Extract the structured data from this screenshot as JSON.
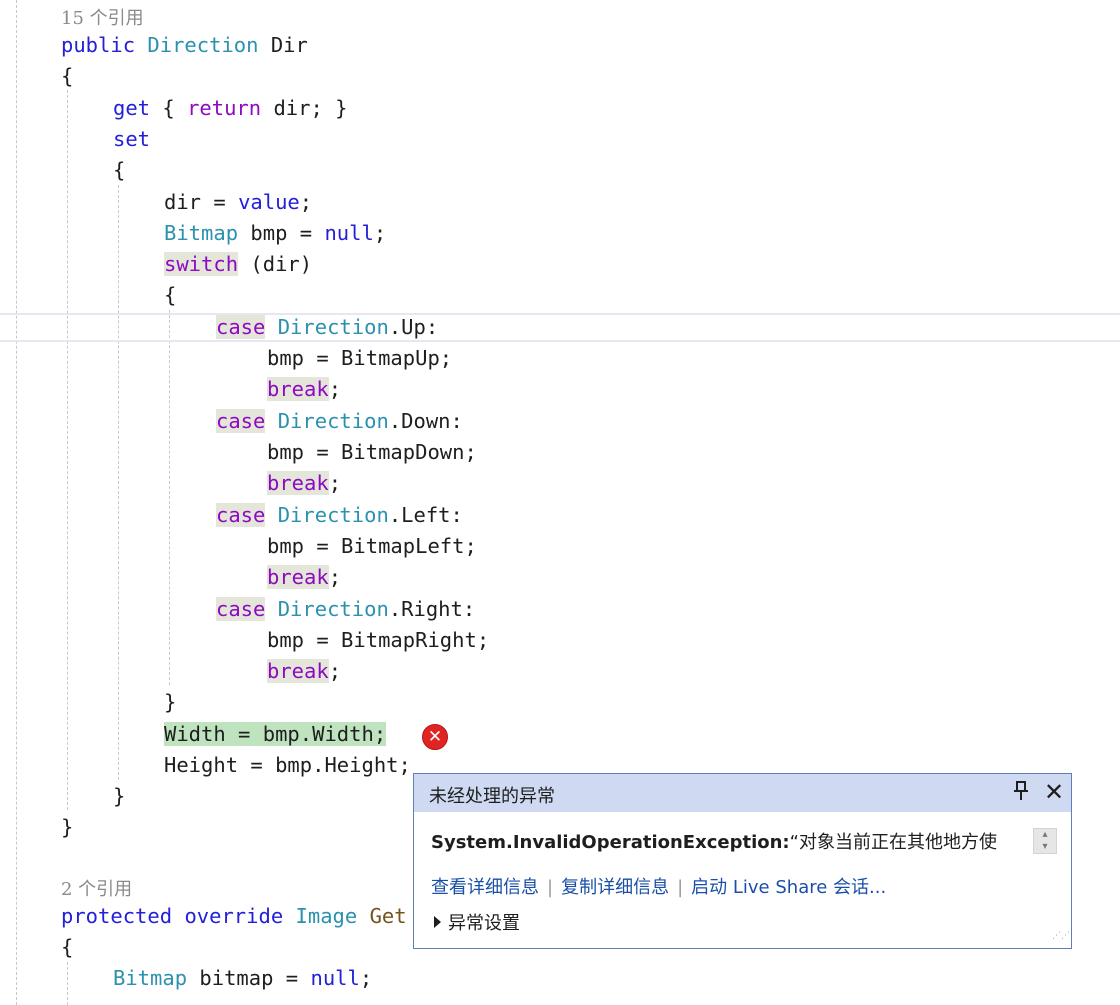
{
  "codelens": {
    "refs_1": "15 个引用",
    "refs_2": "2 个引用"
  },
  "code": {
    "l1_kw": "public",
    "l1_type": "Direction",
    "l1_name": " Dir",
    "l2": "{",
    "l3_get": "get",
    "l3_a": " { ",
    "l3_return": "return",
    "l3_b": " dir; }",
    "l4_set": "set",
    "l5": "{",
    "l6_a": "dir = ",
    "l6_value": "value",
    "l6_b": ";",
    "l7_type": "Bitmap",
    "l7_a": " bmp = ",
    "l7_null": "null",
    "l7_b": ";",
    "l8_switch": "switch",
    "l8_a": " (dir)",
    "l9": "{",
    "case": "case",
    "break": "break",
    "direction": "Direction",
    "up": ".Up:",
    "down": ".Down:",
    "left": ".Left:",
    "right": ".Right:",
    "bmp_up": "bmp = BitmapUp;",
    "bmp_down": "bmp = BitmapDown;",
    "bmp_left": "bmp = BitmapLeft;",
    "bmp_right": "bmp = BitmapRight;",
    "semi": ";",
    "close_switch": "}",
    "width_line": "Width = bmp.Width;",
    "height_line": "Height = bmp.Height;",
    "close_set": "}",
    "close_prop": "}",
    "p_protected": "protected",
    "p_override": "override",
    "p_type": "Image",
    "p_name": "Get",
    "open_method": "{",
    "m_type": "Bitmap",
    "m_a": " bitmap = ",
    "m_null": "null",
    "m_b": ";"
  },
  "error_icon": "error-circle-icon",
  "popup": {
    "title": "未经处理的异常",
    "pin_icon": "pin-icon",
    "close_icon": "close-icon",
    "exception_type": "System.InvalidOperationException:",
    "exception_message": "“对象当前正在其他地方使",
    "link_details": "查看详细信息",
    "link_copy": "复制详细信息",
    "link_liveshare": "启动 Live Share 会话...",
    "settings": "异常设置"
  },
  "colors": {
    "keyword": "#2320d8",
    "control": "#8f08c4",
    "type": "#2b91af",
    "popup_header": "#cfdaf2",
    "popup_border": "#5f7fb7",
    "link": "#1a4fa8",
    "error": "#e02424"
  }
}
